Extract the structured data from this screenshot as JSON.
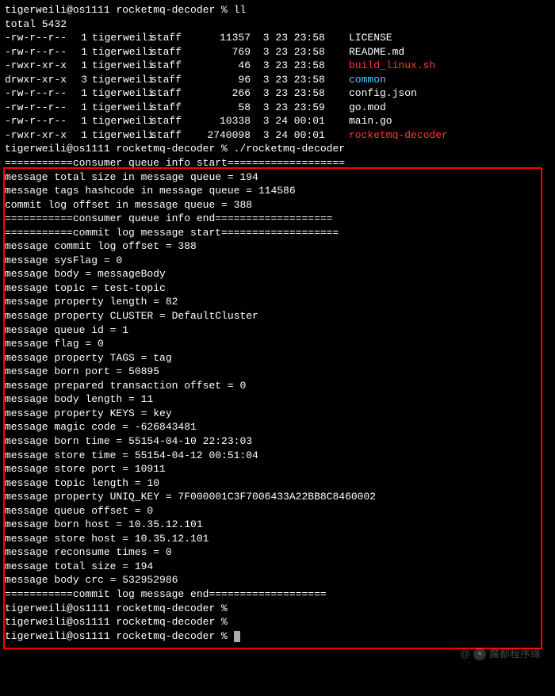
{
  "prompt1": "tigerweili@os1111 rocketmq-decoder % ll",
  "total": "total 5432",
  "files": [
    {
      "perms": "-rw-r--r--",
      "links": "1",
      "owner": "tigerweili",
      "group": "staff",
      "size": "11357",
      "date": " 3 23 23:58",
      "name": "LICENSE",
      "color": "white"
    },
    {
      "perms": "-rw-r--r--",
      "links": "1",
      "owner": "tigerweili",
      "group": "staff",
      "size": "769",
      "date": " 3 23 23:58",
      "name": "README.md",
      "color": "white"
    },
    {
      "perms": "-rwxr-xr-x",
      "links": "1",
      "owner": "tigerweili",
      "group": "staff",
      "size": "46",
      "date": " 3 23 23:58",
      "name": "build_linux.sh",
      "color": "red"
    },
    {
      "perms": "drwxr-xr-x",
      "links": "3",
      "owner": "tigerweili",
      "group": "staff",
      "size": "96",
      "date": " 3 23 23:58",
      "name": "common",
      "color": "blue"
    },
    {
      "perms": "-rw-r--r--",
      "links": "1",
      "owner": "tigerweili",
      "group": "staff",
      "size": "266",
      "date": " 3 23 23:58",
      "name": "config.json",
      "color": "white"
    },
    {
      "perms": "-rw-r--r--",
      "links": "1",
      "owner": "tigerweili",
      "group": "staff",
      "size": "58",
      "date": " 3 23 23:59",
      "name": "go.mod",
      "color": "white"
    },
    {
      "perms": "-rw-r--r--",
      "links": "1",
      "owner": "tigerweili",
      "group": "staff",
      "size": "10338",
      "date": " 3 24 00:01",
      "name": "main.go",
      "color": "white"
    },
    {
      "perms": "-rwxr-xr-x",
      "links": "1",
      "owner": "tigerweili",
      "group": "staff",
      "size": "2740098",
      "date": " 3 24 00:01",
      "name": "rocketmq-decoder",
      "color": "red"
    }
  ],
  "prompt2": "tigerweili@os1111 rocketmq-decoder % ./rocketmq-decoder",
  "output": [
    "===========consumer queue info start===================",
    "message total size in message queue = 194",
    "message tags hashcode in message queue = 114586",
    "commit log offset in message queue = 388",
    "===========consumer queue info end===================",
    "===========commit log message start===================",
    "message commit log offset = 388",
    "message sysFlag = 0",
    "message body = messageBody",
    "message topic = test-topic",
    "message property length = 82",
    "message property CLUSTER = DefaultCluster",
    "message queue id = 1",
    "message flag = 0",
    "message property TAGS = tag",
    "message born port = 50895",
    "message prepared transaction offset = 0",
    "message body length = 11",
    "message property KEYS = key",
    "message magic code = -626843481",
    "message born time = 55154-04-10 22:23:03",
    "message store time = 55154-04-12 00:51:04",
    "message store port = 10911",
    "message topic length = 10",
    "message property UNIQ_KEY = 7F000001C3F7006433A22BB8C8460002",
    "message queue offset = 0",
    "message born host = 10.35.12.101",
    "message store host = 10.35.12.101",
    "message reconsume times = 0",
    "message total size = 194",
    "message body crc = 532952986",
    "===========commit log message end==================="
  ],
  "prompt3": "tigerweili@os1111 rocketmq-decoder %",
  "prompt4": "tigerweili@os1111 rocketmq-decoder %",
  "prompt5": "tigerweili@os1111 rocketmq-decoder % ",
  "watermark": "魔都程序缘"
}
